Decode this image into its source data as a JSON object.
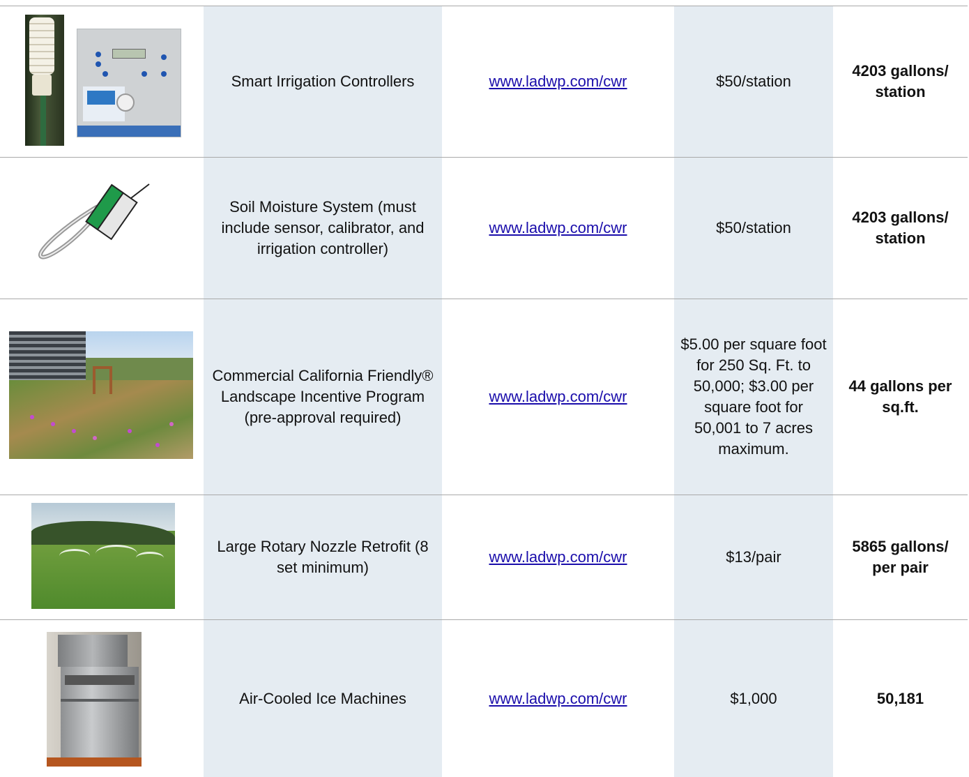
{
  "rows": [
    {
      "program": "Smart Irrigation Controllers",
      "link": "www.ladwp.com/cwr",
      "rebate": "$50/station",
      "savings": "4203 gallons/ station",
      "image": "smart-irrigation-controller-photo"
    },
    {
      "program": "Soil Moisture System (must include sensor, calibrator, and irrigation controller)",
      "link": "www.ladwp.com/cwr",
      "rebate": "$50/station",
      "savings": "4203 gallons/ station",
      "image": "soil-moisture-sensor-illustration"
    },
    {
      "program": "Commercial California Friendly® Landscape Incentive Program (pre-approval required)",
      "link": "www.ladwp.com/cwr",
      "rebate": "$5.00 per square foot for 250 Sq. Ft. to 50,000; $3.00 per square foot for 50,001 to 7 acres maximum.",
      "savings": "44 gallons per sq.ft.",
      "image": "landscape-garden-photo"
    },
    {
      "program": "Large Rotary Nozzle Retrofit (8 set minimum)",
      "link": "www.ladwp.com/cwr",
      "rebate": "$13/pair",
      "savings": "5865 gallons/ per pair",
      "image": "rotary-sprinklers-photo"
    },
    {
      "program": "Air-Cooled Ice Machines",
      "link": "www.ladwp.com/cwr",
      "rebate": "$1,000",
      "savings": "50,181",
      "image": "ice-machine-photo"
    }
  ],
  "colors": {
    "shaded_column": "#e5ecf2",
    "rule": "#a9a9a9",
    "link": "#1a0dab"
  }
}
